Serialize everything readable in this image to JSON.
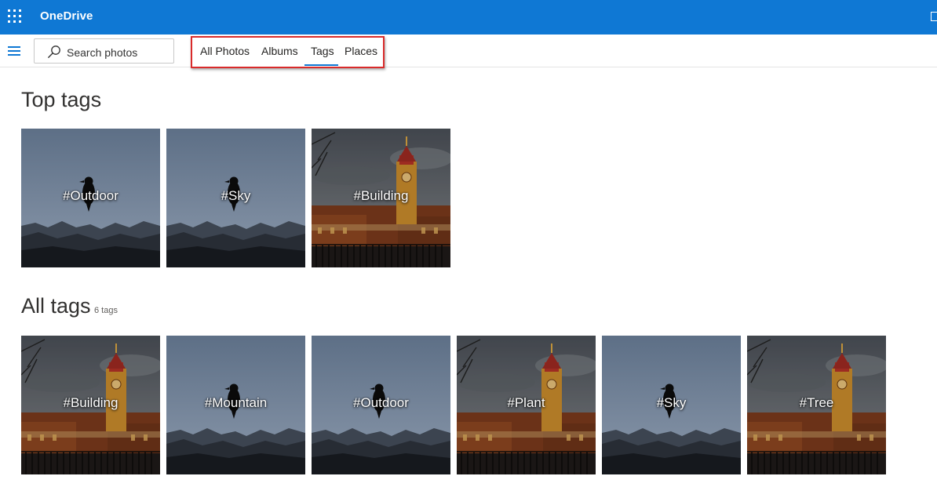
{
  "app": {
    "brand": "OneDrive"
  },
  "search": {
    "placeholder": "Search photos"
  },
  "tabs": [
    {
      "label": "All Photos"
    },
    {
      "label": "Albums"
    },
    {
      "label": "Tags",
      "selected": true
    },
    {
      "label": "Places"
    }
  ],
  "sections": {
    "top_tags": {
      "title": "Top tags",
      "tiles": [
        {
          "label": "#Outdoor",
          "image": "bird-mountains"
        },
        {
          "label": "#Sky",
          "image": "bird-mountains"
        },
        {
          "label": "#Building",
          "image": "clock-tower"
        }
      ]
    },
    "all_tags": {
      "title": "All tags",
      "count_label": "6 tags",
      "tiles": [
        {
          "label": "#Building",
          "image": "clock-tower"
        },
        {
          "label": "#Mountain",
          "image": "bird-mountains"
        },
        {
          "label": "#Outdoor",
          "image": "bird-mountains"
        },
        {
          "label": "#Plant",
          "image": "clock-tower"
        },
        {
          "label": "#Sky",
          "image": "bird-mountains"
        },
        {
          "label": "#Tree",
          "image": "clock-tower"
        }
      ]
    }
  },
  "icons": {
    "app_launcher": "waffle-icon",
    "nav_menu": "hamburger-icon",
    "search": "search-icon"
  },
  "colors": {
    "brand_blue": "#0f78d4",
    "highlight_red": "#d92b2b"
  }
}
